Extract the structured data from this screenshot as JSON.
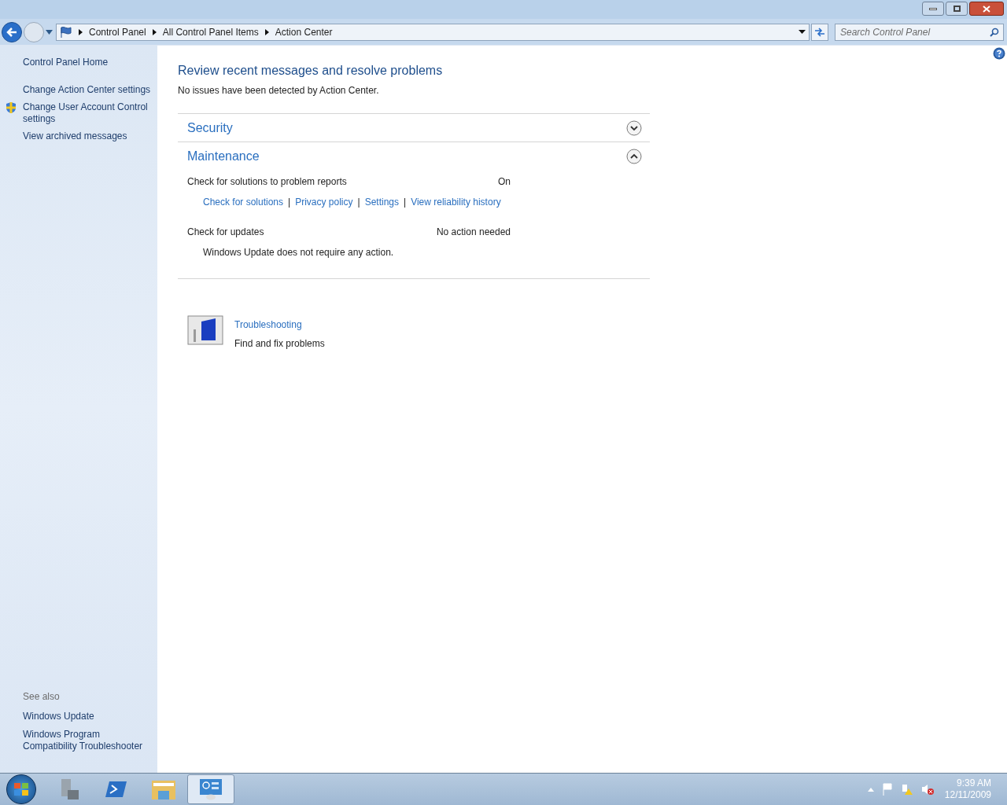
{
  "address_bar": {
    "breadcrumbs": [
      "Control Panel",
      "All Control Panel Items",
      "Action Center"
    ]
  },
  "search": {
    "placeholder": "Search Control Panel"
  },
  "sidebar": {
    "items": [
      {
        "label": "Control Panel Home",
        "shield": false
      },
      {
        "label": "Change Action Center settings",
        "shield": false
      },
      {
        "label": "Change User Account Control settings",
        "shield": true
      },
      {
        "label": "View archived messages",
        "shield": false
      }
    ],
    "see_also": {
      "heading": "See also",
      "items": [
        "Windows Update",
        "Windows Program Compatibility Troubleshooter"
      ]
    }
  },
  "main": {
    "heading": "Review recent messages and resolve problems",
    "subtitle": "No issues have been detected by Action Center.",
    "sections": [
      {
        "title": "Security",
        "expanded": false
      },
      {
        "title": "Maintenance",
        "expanded": true,
        "items": [
          {
            "label": "Check for solutions to problem reports",
            "status": "On",
            "separator": "|",
            "links": [
              "Check for solutions",
              "Privacy policy",
              "Settings",
              "View reliability history"
            ]
          },
          {
            "label": "Check for updates",
            "status": "No action needed",
            "description": "Windows Update does not require any action."
          }
        ]
      }
    ],
    "troubleshooting": {
      "title": "Troubleshooting",
      "description": "Find and fix problems"
    }
  },
  "taskbar": {
    "time": "9:39 AM",
    "date": "12/11/2009",
    "apps": [
      {
        "kind": "server",
        "selected": false
      },
      {
        "kind": "powershell",
        "selected": false
      },
      {
        "kind": "explorer",
        "selected": false
      },
      {
        "kind": "control",
        "selected": true
      }
    ]
  }
}
